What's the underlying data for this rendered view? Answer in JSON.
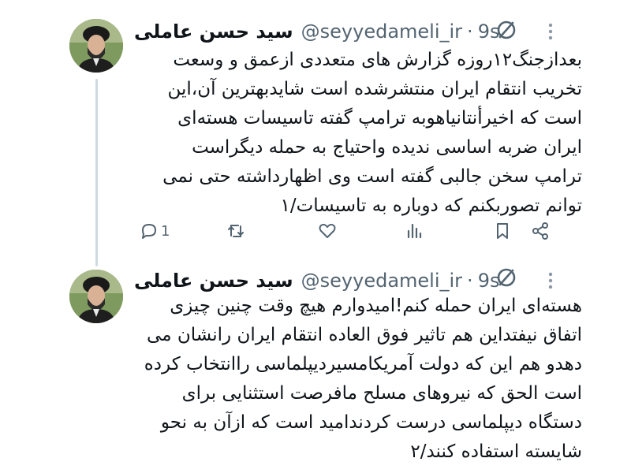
{
  "colors": {
    "text": "#0f1419",
    "secondary": "#536471",
    "thread_line": "#cfd9de"
  },
  "tweets": [
    {
      "display_name": "سید حسن عاملی",
      "handle": "@seyyedameli_ir",
      "separator": "·",
      "time": "9s",
      "icons": [
        "avatar",
        "verified-badge-icon",
        "more-options-icon"
      ],
      "lines": [
        "بعدازجنگ۱۲روزه گزارش های متعددی ازعمق و وسعت",
        "تخریب انتقام ایران منتشرشده است شایدبهترین آن،این",
        "است که اخیرأنتانیاهوبه ترامپ گفته تاسیسات هسته‌ای",
        "ایران ضربه اساسی ندیده واحتیاج به حمله دیگراست",
        "ترامپ سخن جالبی گفته است وی اظهارداشته حتی نمی",
        "توانم تصوربکنم که دوباره به تاسیسات/۱"
      ],
      "actions": {
        "reply_count": "1",
        "icons": [
          "reply-icon",
          "retweet-icon",
          "like-icon",
          "views-icon",
          "bookmark-icon",
          "share-icon"
        ]
      }
    },
    {
      "display_name": "سید حسن عاملی",
      "handle": "@seyyedameli_ir",
      "separator": "·",
      "time": "9s",
      "icons": [
        "avatar",
        "verified-badge-icon",
        "more-options-icon"
      ],
      "lines": [
        "هسته‌ای ایران حمله کنم!امیدوارم هیچ وقت چنین چیزی",
        "اتفاق نیفتداین هم تاثیر فوق العاده انتقام ایران رانشان می",
        "دهدو هم این که دولت آمریکامسیردیپلماسی راانتخاب کرده",
        "است الحق که نیروهای مسلح مافرصت استثنایی برای",
        "دستگاه دیپلماسی درست کردندامید است که ازآن به نحو",
        "شایسته استفاده کنند/۲"
      ]
    }
  ]
}
